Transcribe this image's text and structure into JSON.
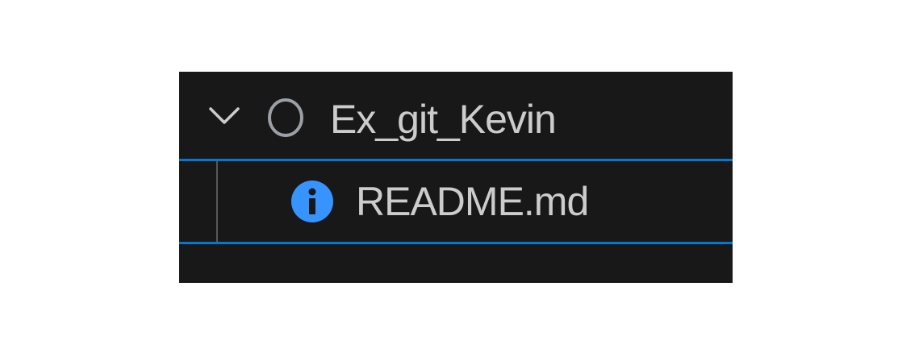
{
  "explorer": {
    "folder": {
      "label": "Ex_git_Kevin",
      "expanded": true,
      "chevron_icon": "chevron-down-icon",
      "status_icon": "circle-outline-icon"
    },
    "files": [
      {
        "label": "README.md",
        "icon": "info-icon",
        "icon_glyph": "i",
        "selected": true
      }
    ]
  },
  "colors": {
    "background": "#181818",
    "text": "#cccccc",
    "selection_border": "#0078d4",
    "info_icon": "#3794ff",
    "indent_guide": "#585858"
  }
}
